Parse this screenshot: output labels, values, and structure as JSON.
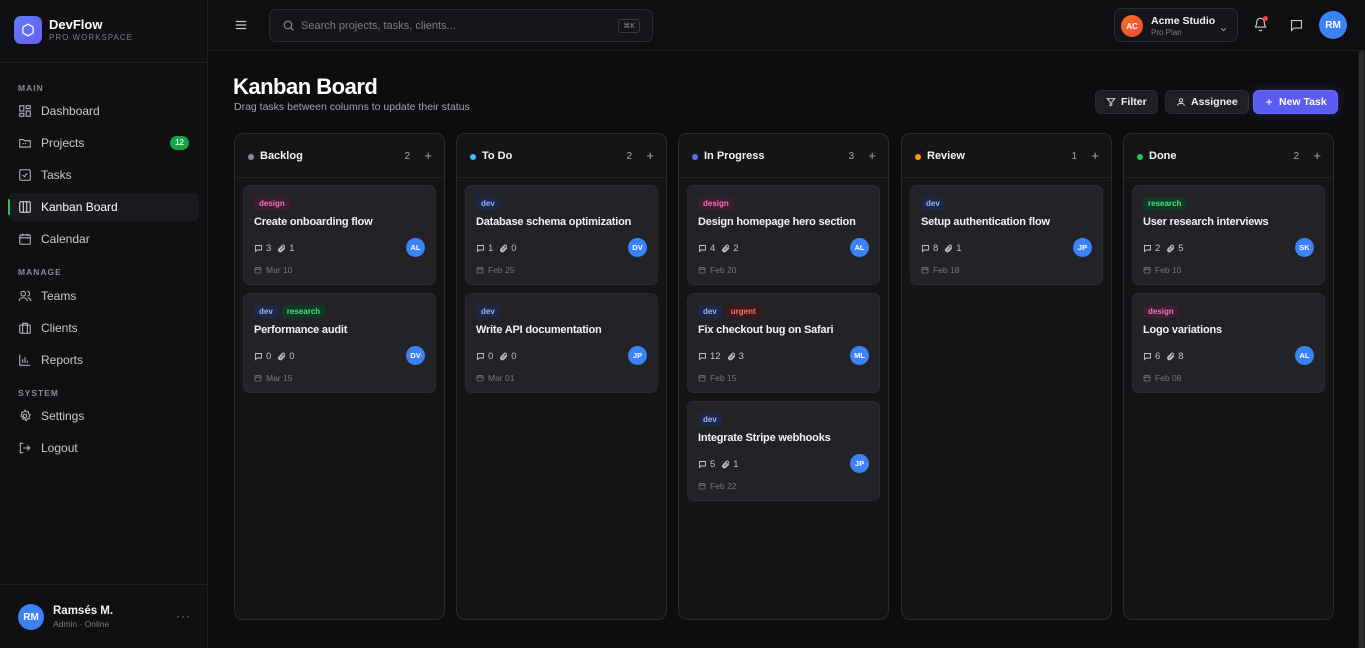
{
  "brand": {
    "name": "DevFlow",
    "sub": "PRO WORKSPACE"
  },
  "nav": {
    "main_label": "MAIN",
    "manage_label": "MANAGE",
    "system_label": "SYSTEM",
    "items": [
      {
        "label": "Dashboard",
        "icon": "dashboard-icon"
      },
      {
        "label": "Projects",
        "icon": "folder-icon",
        "badge": "12"
      },
      {
        "label": "Tasks",
        "icon": "checkbox-icon"
      },
      {
        "label": "Kanban Board",
        "icon": "kanban-icon",
        "active": true
      },
      {
        "label": "Calendar",
        "icon": "calendar-icon"
      },
      {
        "label": "Teams",
        "icon": "users-icon"
      },
      {
        "label": "Clients",
        "icon": "briefcase-icon"
      },
      {
        "label": "Reports",
        "icon": "bar-chart-icon"
      },
      {
        "label": "Settings",
        "icon": "gear-icon"
      },
      {
        "label": "Logout",
        "icon": "logout-icon"
      }
    ]
  },
  "user": {
    "initials": "RM",
    "name": "Ramsés M.",
    "status": "Admin · Online",
    "more": "···"
  },
  "topbar": {
    "search_placeholder": "Search projects, tasks, clients...",
    "search_shortcut": "⌘K",
    "workspace": {
      "initials": "AC",
      "name": "Acme Studio",
      "plan": "Pro Plan"
    },
    "avatar_initials": "RM"
  },
  "page": {
    "title": "Kanban Board",
    "subtitle": "Drag tasks between columns to update their status",
    "filter_label": "Filter",
    "assignee_label": "Assignee",
    "new_task_label": "New Task"
  },
  "colors": {
    "backlog": "#8b8b94",
    "todo": "#38bdf8",
    "in_progress": "#6366f1",
    "review": "#f59e0b",
    "done": "#22c55e",
    "accent": "#5b5cf0"
  },
  "columns": [
    {
      "name": "Backlog",
      "count": "2",
      "add": "+",
      "cards": [
        {
          "tags": [
            "design"
          ],
          "title": "Create onboarding flow",
          "comments": "3",
          "attachments": "1",
          "date": "Mar 10",
          "assignee": "AL"
        },
        {
          "tags": [
            "dev",
            "research"
          ],
          "title": "Performance audit",
          "comments": "0",
          "attachments": "0",
          "date": "Mar 15",
          "assignee": "DV"
        }
      ]
    },
    {
      "name": "To Do",
      "count": "2",
      "add": "+",
      "cards": [
        {
          "tags": [
            "dev"
          ],
          "title": "Database schema optimization",
          "comments": "1",
          "attachments": "0",
          "date": "Feb 25",
          "assignee": "DV"
        },
        {
          "tags": [
            "dev"
          ],
          "title": "Write API documentation",
          "comments": "0",
          "attachments": "0",
          "date": "Mar 01",
          "assignee": "JP"
        }
      ]
    },
    {
      "name": "In Progress",
      "count": "3",
      "add": "+",
      "cards": [
        {
          "tags": [
            "design"
          ],
          "title": "Design homepage hero section",
          "comments": "4",
          "attachments": "2",
          "date": "Feb 20",
          "assignee": "AL"
        },
        {
          "tags": [
            "dev",
            "urgent"
          ],
          "title": "Fix checkout bug on Safari",
          "comments": "12",
          "attachments": "3",
          "date": "Feb 15",
          "assignee": "ML"
        },
        {
          "tags": [
            "dev"
          ],
          "title": "Integrate Stripe webhooks",
          "comments": "5",
          "attachments": "1",
          "date": "Feb 22",
          "assignee": "JP"
        }
      ]
    },
    {
      "name": "Review",
      "count": "1",
      "add": "+",
      "cards": [
        {
          "tags": [
            "dev"
          ],
          "title": "Setup authentication flow",
          "comments": "8",
          "attachments": "1",
          "date": "Feb 18",
          "assignee": "JP"
        }
      ]
    },
    {
      "name": "Done",
      "count": "2",
      "add": "+",
      "cards": [
        {
          "tags": [
            "research"
          ],
          "title": "User research interviews",
          "comments": "2",
          "attachments": "5",
          "date": "Feb 10",
          "assignee": "SK"
        },
        {
          "tags": [
            "design"
          ],
          "title": "Logo variations",
          "comments": "6",
          "attachments": "8",
          "date": "Feb 08",
          "assignee": "AL"
        }
      ]
    }
  ]
}
